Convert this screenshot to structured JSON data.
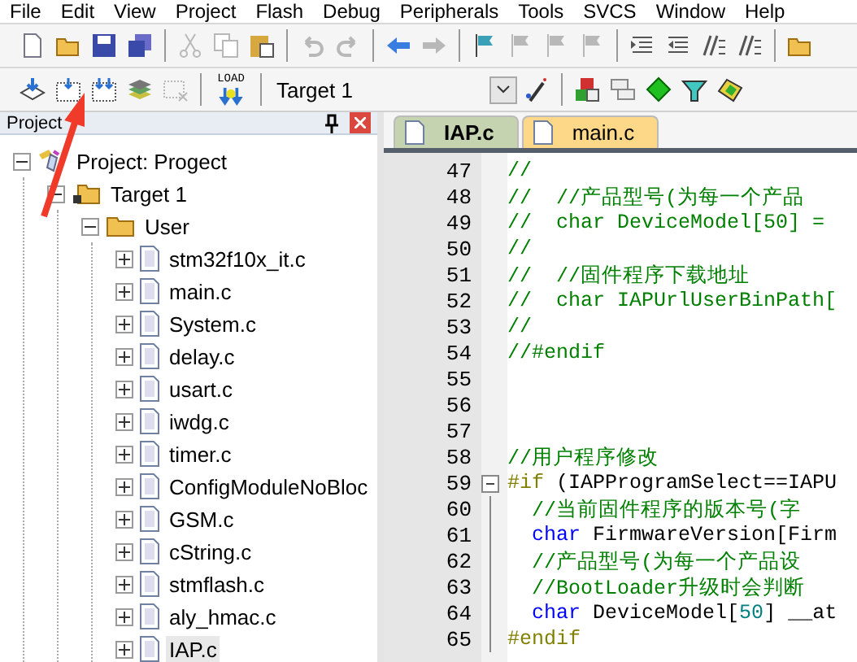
{
  "menu": [
    "File",
    "Edit",
    "View",
    "Project",
    "Flash",
    "Debug",
    "Peripherals",
    "Tools",
    "SVCS",
    "Window",
    "Help"
  ],
  "toolbar_main": [
    {
      "kind": "new",
      "disabled": false
    },
    {
      "kind": "open",
      "disabled": false
    },
    {
      "kind": "save",
      "disabled": false
    },
    {
      "kind": "saveall",
      "disabled": false
    },
    {
      "kind": "sep"
    },
    {
      "kind": "cut",
      "disabled": true
    },
    {
      "kind": "copy",
      "disabled": true
    },
    {
      "kind": "paste",
      "disabled": false
    },
    {
      "kind": "sep"
    },
    {
      "kind": "undo",
      "disabled": true
    },
    {
      "kind": "redo",
      "disabled": true
    },
    {
      "kind": "sep"
    },
    {
      "kind": "back",
      "disabled": false
    },
    {
      "kind": "forward",
      "disabled": true
    },
    {
      "kind": "sep"
    },
    {
      "kind": "flag",
      "disabled": false
    },
    {
      "kind": "flagprev",
      "disabled": true
    },
    {
      "kind": "flagnext",
      "disabled": true
    },
    {
      "kind": "flagclear",
      "disabled": true
    },
    {
      "kind": "sep"
    },
    {
      "kind": "indent",
      "disabled": false
    },
    {
      "kind": "unindent",
      "disabled": false
    },
    {
      "kind": "comment",
      "disabled": false
    },
    {
      "kind": "uncomment",
      "disabled": false
    },
    {
      "kind": "sep"
    },
    {
      "kind": "open"
    }
  ],
  "toolbar_build": {
    "before": [
      {
        "kind": "download",
        "disabled": false
      },
      {
        "kind": "translate",
        "disabled": false
      },
      {
        "kind": "build",
        "disabled": false
      },
      {
        "kind": "layers",
        "disabled": false
      },
      {
        "kind": "batch",
        "disabled": true
      },
      {
        "kind": "sep"
      },
      {
        "kind": "load"
      },
      {
        "kind": "sep"
      }
    ],
    "target": "Target 1",
    "after": [
      {
        "kind": "wand"
      },
      {
        "kind": "sep"
      },
      {
        "kind": "blocks"
      },
      {
        "kind": "windows"
      },
      {
        "kind": "diamond"
      },
      {
        "kind": "funnel"
      },
      {
        "kind": "packs"
      }
    ],
    "load_label": "LOAD"
  },
  "project_panel": {
    "title": "Project",
    "tree": [
      {
        "label": "Project: Progect",
        "kind": "project",
        "expanded": true,
        "children": [
          {
            "label": "Target 1",
            "kind": "target",
            "expanded": true,
            "children": [
              {
                "label": "User",
                "kind": "folder",
                "expanded": true,
                "children": [
                  {
                    "label": "stm32f10x_it.c",
                    "kind": "file",
                    "expanded": false,
                    "selected": false
                  },
                  {
                    "label": "main.c",
                    "kind": "file",
                    "expanded": false,
                    "selected": false
                  },
                  {
                    "label": "System.c",
                    "kind": "file",
                    "expanded": false,
                    "selected": false
                  },
                  {
                    "label": "delay.c",
                    "kind": "file",
                    "expanded": false,
                    "selected": false
                  },
                  {
                    "label": "usart.c",
                    "kind": "file",
                    "expanded": false,
                    "selected": false
                  },
                  {
                    "label": "iwdg.c",
                    "kind": "file",
                    "expanded": false,
                    "selected": false
                  },
                  {
                    "label": "timer.c",
                    "kind": "file",
                    "expanded": false,
                    "selected": false
                  },
                  {
                    "label": "ConfigModuleNoBloc",
                    "kind": "file",
                    "expanded": false,
                    "selected": false
                  },
                  {
                    "label": "GSM.c",
                    "kind": "file",
                    "expanded": false,
                    "selected": false
                  },
                  {
                    "label": "cString.c",
                    "kind": "file",
                    "expanded": false,
                    "selected": false
                  },
                  {
                    "label": "stmflash.c",
                    "kind": "file",
                    "expanded": false,
                    "selected": false
                  },
                  {
                    "label": "aly_hmac.c",
                    "kind": "file",
                    "expanded": false,
                    "selected": false
                  },
                  {
                    "label": "IAP.c",
                    "kind": "file",
                    "expanded": false,
                    "selected": true
                  }
                ]
              }
            ]
          }
        ]
      }
    ]
  },
  "editor": {
    "tabs": [
      {
        "label": "IAP.c",
        "selected": true
      },
      {
        "label": "main.c",
        "selected": false
      }
    ],
    "lines": [
      {
        "number": "47",
        "fold_start": false,
        "in_fold": false,
        "code": [
          {
            "kind": "comment",
            "text": "//"
          }
        ]
      },
      {
        "number": "48",
        "fold_start": false,
        "in_fold": false,
        "code": [
          {
            "kind": "comment",
            "text": "//  //产品型号(为每一个产品"
          }
        ]
      },
      {
        "number": "49",
        "fold_start": false,
        "in_fold": false,
        "code": [
          {
            "kind": "comment",
            "text": "//  char DeviceModel[50] ="
          }
        ]
      },
      {
        "number": "50",
        "fold_start": false,
        "in_fold": false,
        "code": [
          {
            "kind": "comment",
            "text": "//"
          }
        ]
      },
      {
        "number": "51",
        "fold_start": false,
        "in_fold": false,
        "code": [
          {
            "kind": "comment",
            "text": "//  //固件程序下载地址"
          }
        ]
      },
      {
        "number": "52",
        "fold_start": false,
        "in_fold": false,
        "code": [
          {
            "kind": "comment",
            "text": "//  char IAPUrlUserBinPath["
          }
        ]
      },
      {
        "number": "53",
        "fold_start": false,
        "in_fold": false,
        "code": [
          {
            "kind": "comment",
            "text": "//"
          }
        ]
      },
      {
        "number": "54",
        "fold_start": false,
        "in_fold": false,
        "code": [
          {
            "kind": "comment",
            "text": "//#endif"
          }
        ]
      },
      {
        "number": "55",
        "fold_start": false,
        "in_fold": false
      },
      {
        "number": "56",
        "fold_start": false,
        "in_fold": false
      },
      {
        "number": "57",
        "fold_start": false,
        "in_fold": false
      },
      {
        "number": "58",
        "fold_start": false,
        "in_fold": false,
        "code": [
          {
            "kind": "comment",
            "text": "//用户程序修改"
          }
        ]
      },
      {
        "number": "59",
        "fold_start": true,
        "in_fold": false,
        "code": [
          {
            "kind": "preproc",
            "text": "#if"
          },
          {
            "kind": "plain",
            "text": " (IAPProgramSelect==IAPU"
          }
        ]
      },
      {
        "number": "60",
        "fold_start": false,
        "in_fold": true,
        "code": [
          {
            "kind": "comment",
            "text": "  //当前固件程序的版本号(字"
          }
        ]
      },
      {
        "number": "61",
        "fold_start": false,
        "in_fold": true,
        "code": [
          {
            "kind": "keyword",
            "text": "  char"
          },
          {
            "kind": "plain",
            "text": " FirmwareVersion[Firm"
          }
        ]
      },
      {
        "number": "62",
        "fold_start": false,
        "in_fold": true,
        "code": [
          {
            "kind": "comment",
            "text": "  //产品型号(为每一个产品设"
          }
        ]
      },
      {
        "number": "63",
        "fold_start": false,
        "in_fold": true,
        "code": [
          {
            "kind": "comment",
            "text": "  //BootLoader升级时会判断"
          }
        ]
      },
      {
        "number": "64",
        "fold_start": false,
        "in_fold": true,
        "code": [
          {
            "kind": "keyword",
            "text": "  char"
          },
          {
            "kind": "plain",
            "text": " DeviceModel["
          },
          {
            "kind": "number",
            "text": "50"
          },
          {
            "kind": "plain",
            "text": "] __at"
          }
        ]
      },
      {
        "number": "65",
        "fold_start": false,
        "in_fold": true,
        "code": [
          {
            "kind": "preproc",
            "text": "#endif"
          }
        ]
      }
    ]
  }
}
